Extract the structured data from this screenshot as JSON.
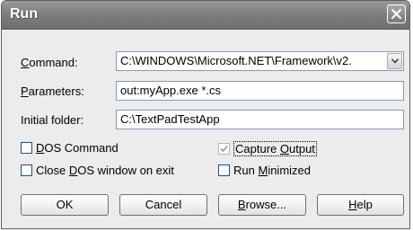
{
  "window": {
    "title": "Run"
  },
  "fields": {
    "command": {
      "label_prefix": "",
      "label_accel": "C",
      "label_rest": "ommand:",
      "value": "C:\\WINDOWS\\Microsoft.NET\\Framework\\v2."
    },
    "parameters": {
      "label_prefix": "",
      "label_accel": "P",
      "label_rest": "arameters:",
      "value": "out:myApp.exe *.cs"
    },
    "initial_folder": {
      "label": "Initial folder:",
      "value": "C:\\TextPadTestApp"
    }
  },
  "options": {
    "dos_command": {
      "prefix": "",
      "accel": "D",
      "rest": "OS Command",
      "checked": false
    },
    "capture_output": {
      "prefix": "Capture ",
      "accel": "O",
      "rest": "utput",
      "checked": true,
      "enabled": false
    },
    "close_dos": {
      "prefix": "Close ",
      "accel": "D",
      "rest": "OS window on exit",
      "checked": false
    },
    "run_minimized": {
      "prefix": "Run ",
      "accel": "M",
      "rest": "inimized",
      "checked": false
    }
  },
  "buttons": {
    "ok": "OK",
    "cancel": "Cancel",
    "browse": {
      "prefix": "",
      "accel": "B",
      "rest": "rowse..."
    },
    "help": {
      "prefix": "",
      "accel": "H",
      "rest": "elp"
    }
  },
  "icons": {
    "close": "close-icon",
    "dropdown": "chevron-down-icon",
    "check": "check-icon"
  },
  "colors": {
    "titlebar": "#7e7e7e",
    "dialog_bg": "#ececec",
    "field_border": "#7f9db9",
    "checkbox_border": "#1c5180"
  }
}
